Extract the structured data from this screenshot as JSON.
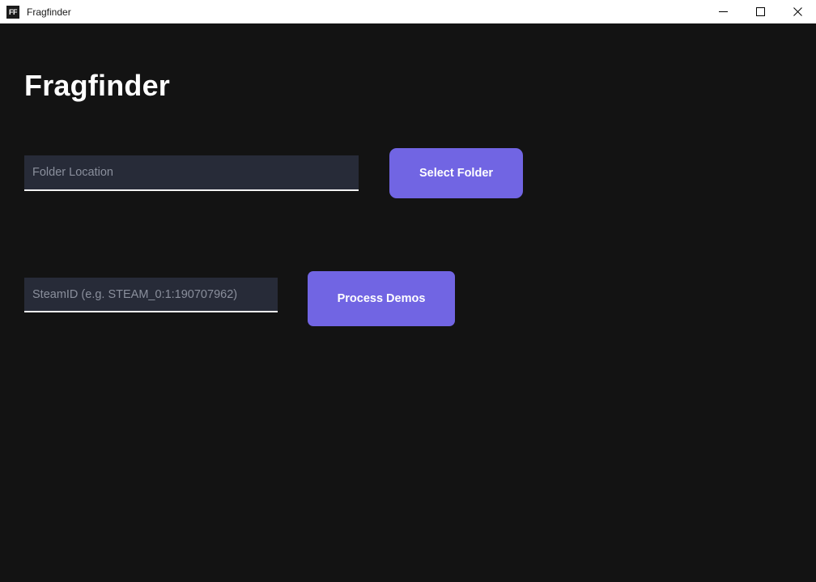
{
  "window": {
    "title": "Fragfinder",
    "icon_label": "FF",
    "icon_name": "app-icon",
    "controls": {
      "minimize": "minimize-icon",
      "maximize": "maximize-icon",
      "close": "close-icon"
    }
  },
  "app": {
    "heading": "Fragfinder"
  },
  "form": {
    "folder": {
      "placeholder": "Folder Location",
      "value": ""
    },
    "steamid": {
      "placeholder": "SteamID (e.g. STEAM_0:1:190707962)",
      "value": ""
    }
  },
  "buttons": {
    "select_folder": "Select Folder",
    "process_demos": "Process Demos"
  },
  "colors": {
    "background": "#131313",
    "titlebar": "#ffffff",
    "titlebar_text": "#1a1a1a",
    "accent": "#7165e3",
    "field_background": "#272b38",
    "field_underline": "#f2f2f2",
    "placeholder": "#8a8f9c",
    "heading_text": "#ffffff"
  }
}
